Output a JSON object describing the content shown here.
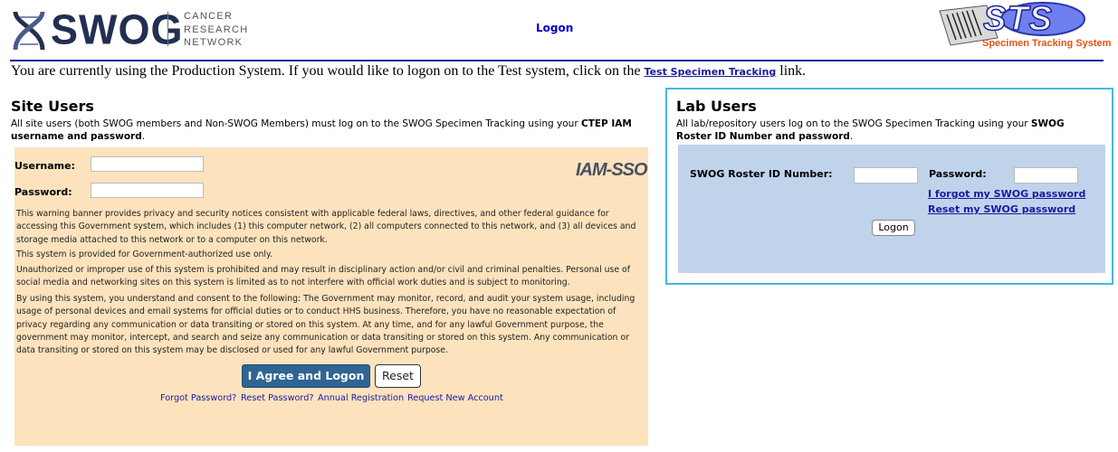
{
  "header": {
    "logo_name": "SWOG",
    "logo_sub": [
      "CANCER",
      "RESEARCH",
      "NETWORK"
    ],
    "page_title": "Logon",
    "sts_logo_text": "STS",
    "sts_logo_sub": "Specimen Tracking System"
  },
  "notice": {
    "prefix": "You are currently using the Production System. If you would like to logon on to the Test system, click on the ",
    "link": "Test Specimen Tracking",
    "suffix": " link."
  },
  "site_users": {
    "title": "Site Users",
    "desc_prefix": "All site users (both SWOG members and Non-SWOG Members) must log on to the SWOG Specimen Tracking using your ",
    "desc_bold": "CTEP IAM username and password",
    "desc_suffix": ".",
    "username_label": "Username:",
    "password_label": "Password:",
    "username_value": "",
    "password_value": "",
    "iam_logo": "IAM-SSO",
    "warnings": [
      "This warning banner provides privacy and security notices consistent with applicable federal laws, directives, and other federal guidance for accessing this Government system, which includes (1) this computer network, (2) all computers connected to this network, and (3) all devices and storage media attached to this network or to a computer on this network.",
      "This system is provided for Government-authorized use only.",
      "Unauthorized or improper use of this system is prohibited and may result in disciplinary action and/or civil and criminal penalties. Personal use of social media and networking sites on this system is limited as to not interfere with official work duties and is subject to monitoring.",
      "By using this system, you understand and consent to the following: The Government may monitor, record, and audit your system usage, including usage of personal devices and email systems for official duties or to conduct HHS business. Therefore, you have no reasonable expectation of privacy regarding any communication or data transiting or stored on this system. At any time, and for any lawful Government purpose, the government may monitor, intercept, and search and seize any communication or data transiting or stored on this system. Any communication or data transiting or stored on this system may be disclosed or used for any lawful Government purpose."
    ],
    "agree_button": "I Agree and Logon",
    "reset_button": "Reset",
    "links": [
      "Forgot Password?",
      "Reset Password?",
      "Annual Registration",
      "Request New Account"
    ]
  },
  "lab_users": {
    "title": "Lab Users",
    "desc_prefix": "All lab/repository users log on to the SWOG Specimen Tracking using your ",
    "desc_bold": "SWOG Roster ID Number and password",
    "desc_suffix": ".",
    "roster_label": "SWOG Roster ID Number:",
    "password_label": "Password:",
    "roster_value": "",
    "password_value": "",
    "forgot_link": "I forgot my SWOG password",
    "reset_link": "Reset my SWOG password",
    "logon_button": "Logon"
  },
  "colors": {
    "site_panel": "#fce3bd",
    "lab_panel": "#bfd3ea",
    "lab_border": "#49b7e6",
    "primary_button": "#2f6493",
    "link": "#1a1aa0"
  }
}
